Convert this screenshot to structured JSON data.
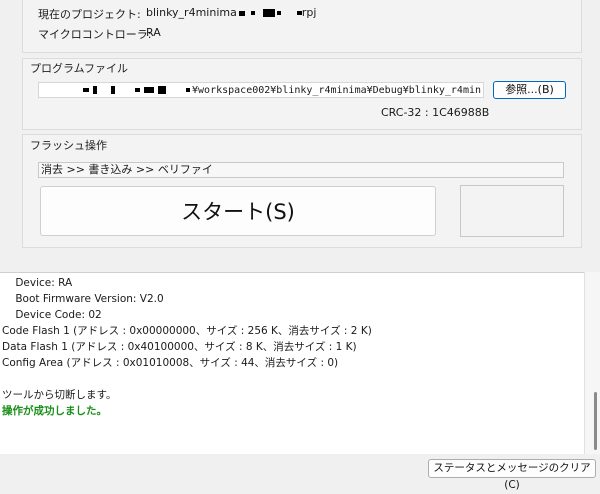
{
  "project": {
    "current_project_label": "現在のプロジェクト:",
    "current_project_value": "blinky_r4minima",
    "current_project_ext": "rpj",
    "microcontroller_label": "マイクロコントローラ:",
    "microcontroller_value": "RA"
  },
  "program_file": {
    "title": "プログラムファイル",
    "path": "¥workspace002¥blinky_r4minima¥Debug¥blinky_r4min",
    "browse_label": "参照...(B)",
    "crc_text": "CRC-32 : 1C46988B"
  },
  "flash": {
    "title": "フラッシュ操作",
    "operation": "消去 >> 書き込み >> ベリファイ",
    "start_label": "スタート(S)"
  },
  "log": {
    "lines": [
      "    Device: RA",
      "    Boot Firmware Version: V2.0",
      "    Device Code: 02",
      "Code Flash 1 (アドレス : 0x00000000、サイズ : 256 K、消去サイズ : 2 K)",
      "Data Flash 1 (アドレス : 0x40100000、サイズ : 8 K、消去サイズ : 1 K)",
      "Config Area (アドレス : 0x01010008、サイズ : 44、消去サイズ : 0)",
      "",
      "ツールから切断します。"
    ],
    "success": "操作が成功しました。"
  },
  "footer": {
    "clear_label": "ステータスとメッセージのクリア(C)"
  }
}
